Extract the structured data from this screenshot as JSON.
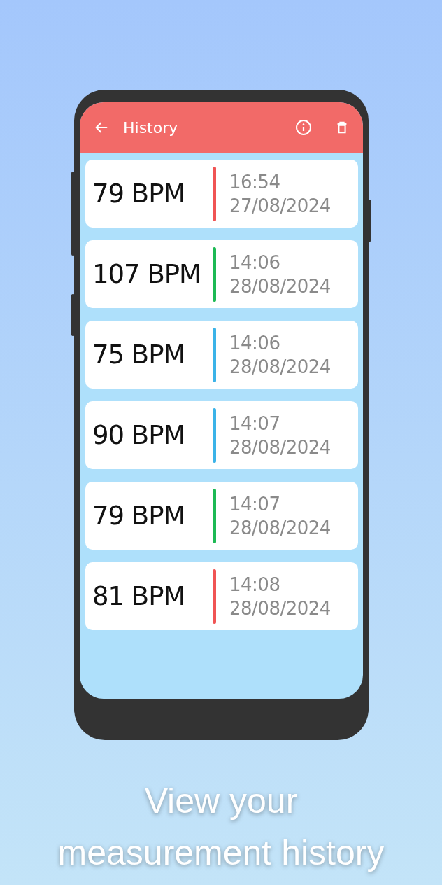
{
  "app_bar": {
    "title": "History"
  },
  "entries": [
    {
      "reading": "79 BPM",
      "time": "16:54",
      "date": "27/08/2024",
      "color": "#f05454"
    },
    {
      "reading": "107 BPM",
      "time": "14:06",
      "date": "28/08/2024",
      "color": "#1db954"
    },
    {
      "reading": "75 BPM",
      "time": "14:06",
      "date": "28/08/2024",
      "color": "#3bb3e8"
    },
    {
      "reading": "90 BPM",
      "time": "14:07",
      "date": "28/08/2024",
      "color": "#3bb3e8"
    },
    {
      "reading": "79 BPM",
      "time": "14:07",
      "date": "28/08/2024",
      "color": "#1db954"
    },
    {
      "reading": "81 BPM",
      "time": "14:08",
      "date": "28/08/2024",
      "color": "#f05454"
    }
  ],
  "caption": [
    "View your",
    "measurement history"
  ]
}
